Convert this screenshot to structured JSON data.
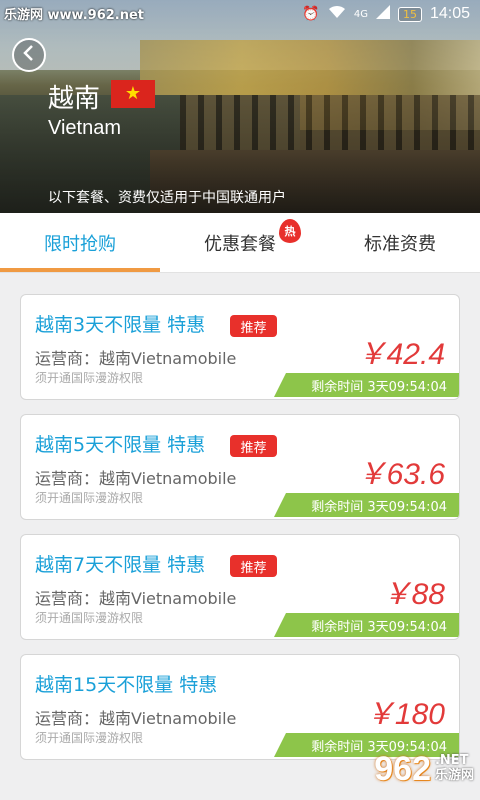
{
  "status_bar": {
    "watermark": "乐游网 www.962.net",
    "network": "4G",
    "battery": "15",
    "time": "14:05"
  },
  "header": {
    "country_cn": "越南",
    "country_en": "Vietnam",
    "flag_symbol": "★",
    "flag_color": "#da251d",
    "note": "以下套餐、资费仅适用于中国联通用户"
  },
  "tabs": [
    {
      "label": "限时抢购",
      "active": true
    },
    {
      "label": "优惠套餐",
      "badge": "热"
    },
    {
      "label": "标准资费"
    }
  ],
  "colors": {
    "accent": "#1aa0d8",
    "price": "#e23a3a",
    "countdown_bg": "#8dc54a",
    "tab_underline": "#f09a43",
    "badge": "#e8302b"
  },
  "packages": [
    {
      "title": "越南3天不限量 特惠",
      "badge": "推荐",
      "operator": "运营商：越南Vietnamobile",
      "note": "须开通国际漫游权限",
      "price": "￥42.4",
      "countdown": "剩余时间 3天09:54:04"
    },
    {
      "title": "越南5天不限量 特惠",
      "badge": "推荐",
      "operator": "运营商：越南Vietnamobile",
      "note": "须开通国际漫游权限",
      "price": "￥63.6",
      "countdown": "剩余时间 3天09:54:04"
    },
    {
      "title": "越南7天不限量 特惠",
      "badge": "推荐",
      "operator": "运营商：越南Vietnamobile",
      "note": "须开通国际漫游权限",
      "price": "￥88",
      "countdown": "剩余时间 3天09:54:04"
    },
    {
      "title": "越南15天不限量 特惠",
      "operator": "运营商：越南Vietnamobile",
      "note": "须开通国际漫游权限",
      "price": "￥180",
      "countdown": "剩余时间 3天09:54:04"
    }
  ],
  "watermark_bottom": {
    "number": "962",
    "suffix": ".NET",
    "text": "乐游网"
  }
}
